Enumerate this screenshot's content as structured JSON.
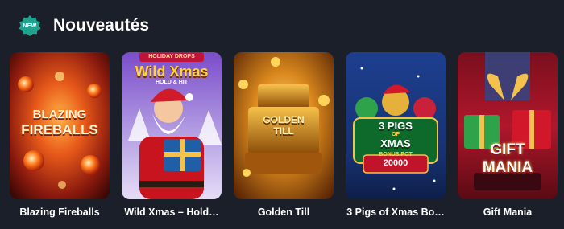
{
  "section": {
    "badge_text": "NEW",
    "badge_icon": "new-badge-icon",
    "title": "Nouveautés",
    "badge_color": "#1fa38e"
  },
  "games": [
    {
      "title": "Blazing Fireballs",
      "art_lines": [
        "BLAZING",
        "FIREBALLS"
      ],
      "art_top": "",
      "art_sub": ""
    },
    {
      "title": "Wild Xmas – Hold…",
      "art_lines": [
        "Wild Xmas"
      ],
      "art_top": "HOLIDAY DROPS",
      "art_sub": "HOLD & HIT"
    },
    {
      "title": "Golden Till",
      "art_lines": [
        "GOLDEN",
        "TILL"
      ],
      "art_top": "",
      "art_sub": ""
    },
    {
      "title": "3 Pigs of Xmas Bo…",
      "art_lines": [
        "3 PIGS",
        "XMAS"
      ],
      "art_top": "",
      "art_sub": "BONUS POT",
      "art_number": "20000",
      "art_of": "OF"
    },
    {
      "title": "Gift Mania",
      "art_lines": [
        "GIFT",
        "MANIA"
      ],
      "art_top": "",
      "art_sub": ""
    }
  ]
}
